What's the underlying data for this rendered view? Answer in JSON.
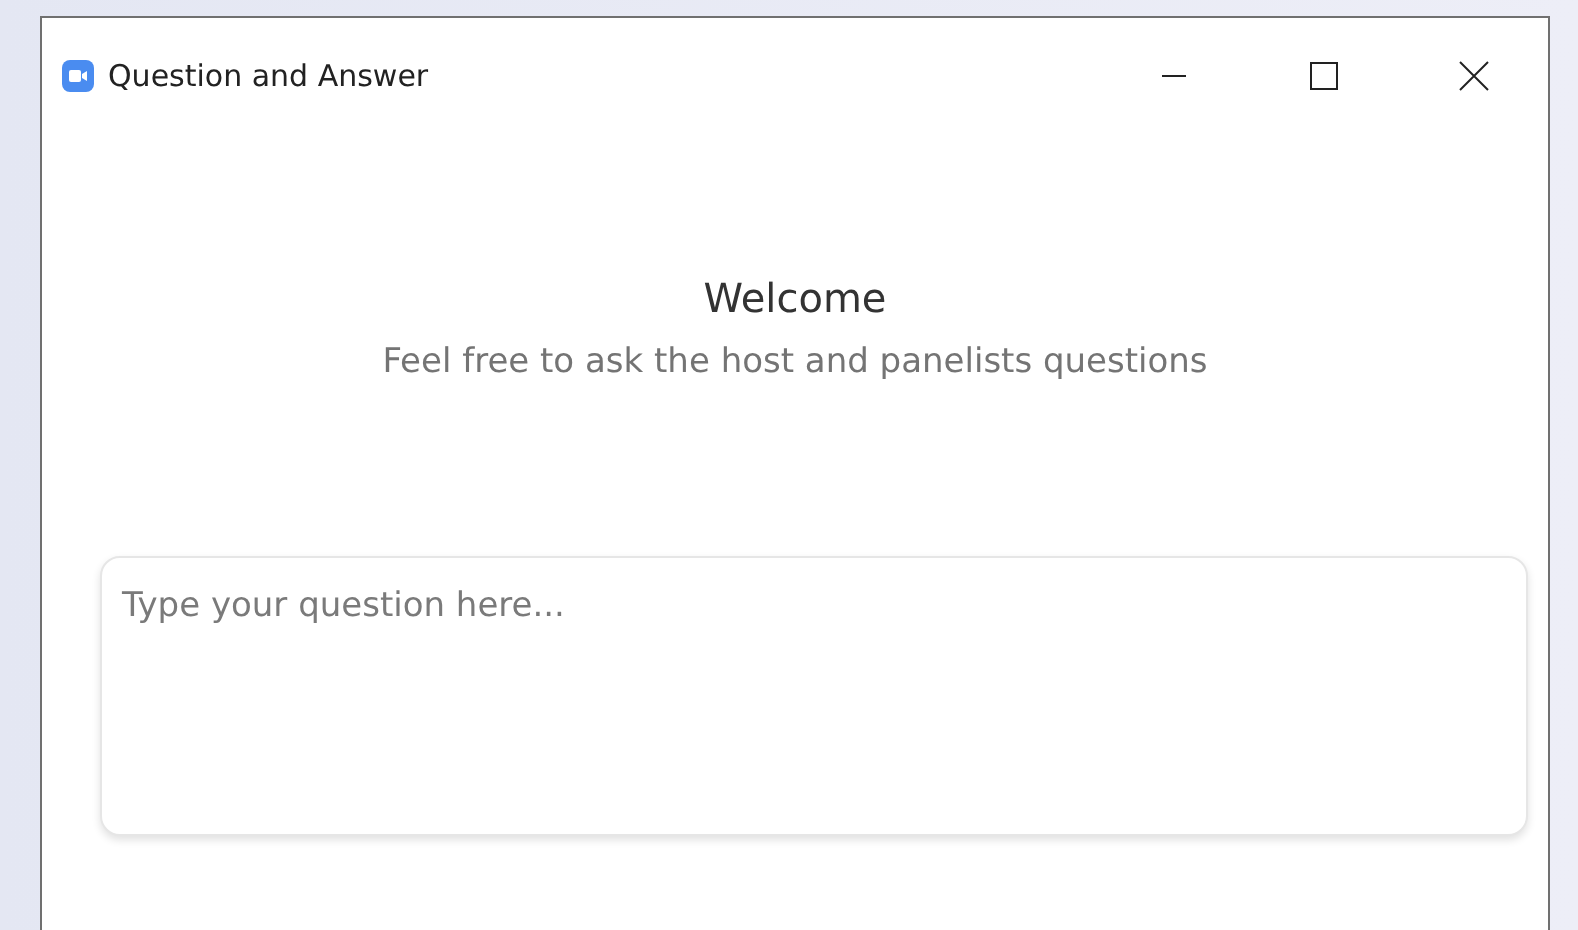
{
  "window": {
    "title": "Question and Answer"
  },
  "welcome": {
    "heading": "Welcome",
    "subtitle": "Feel free to ask the host and panelists questions"
  },
  "question_field": {
    "placeholder": "Type your question here..."
  }
}
